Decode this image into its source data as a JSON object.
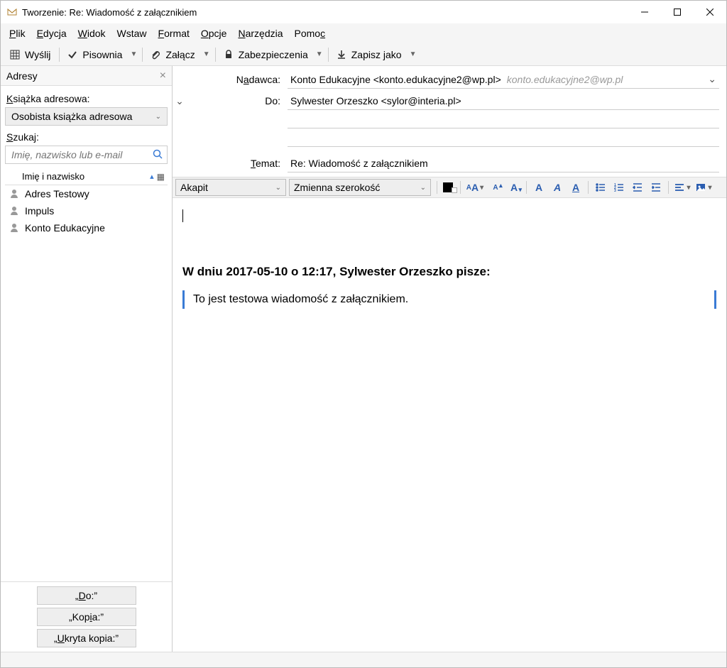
{
  "window": {
    "title": "Tworzenie: Re: Wiadomość z załącznikiem"
  },
  "menu": {
    "plik": "Plik",
    "edycja": "Edycja",
    "widok": "Widok",
    "wstaw": "Wstaw",
    "format": "Format",
    "opcje": "Opcje",
    "narzedzia": "Narzędzia",
    "pomoc": "Pomoc"
  },
  "toolbar": {
    "wyslij": "Wyślij",
    "pisownia": "Pisownia",
    "zalacz": "Załącz",
    "zabezpieczenia": "Zabezpieczenia",
    "zapisz": "Zapisz jako"
  },
  "sidebar": {
    "title": "Adresy",
    "ksiazka_label": "Książka adresowa:",
    "ksiazka_value": "Osobista książka adresowa",
    "szukaj_label": "Szukaj:",
    "szukaj_placeholder": "Imię, nazwisko lub e-mail",
    "listhead": "Imię i nazwisko",
    "contacts": [
      "Adres Testowy",
      "Impuls",
      "Konto Edukacyjne"
    ],
    "btn_do": "„Do:”",
    "btn_kopia": "„Kopia:”",
    "btn_ukryta": "„Ukryta kopia:”"
  },
  "fields": {
    "nadawca_label": "Nadawca:",
    "nadawca_value": "Konto Edukacyjne <konto.edukacyjne2@wp.pl>",
    "nadawca_gray": "konto.edukacyjne2@wp.pl",
    "do_label": "Do:",
    "do_value": "Sylwester Orzeszko <sylor@interia.pl>",
    "temat_label": "Temat:",
    "temat_value": "Re: Wiadomość z załącznikiem"
  },
  "formatbar": {
    "para": "Akapit",
    "font": "Zmienna szerokość"
  },
  "body": {
    "quote_header": "W dniu 2017-05-10 o 12:17, Sylwester Orzeszko pisze:",
    "quote_text": "To jest testowa wiadomość z załącznikiem."
  }
}
